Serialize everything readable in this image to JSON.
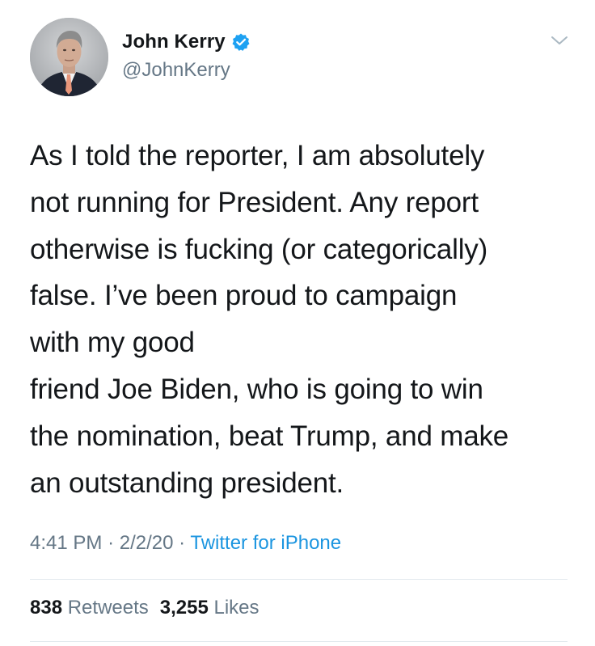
{
  "user": {
    "display_name": "John Kerry",
    "handle": "@JohnKerry",
    "verified": true,
    "avatar_icon": "profile-photo"
  },
  "menu": {
    "icon": "chevron-down-icon"
  },
  "tweet": {
    "lines": [
      "As I told the reporter, I am absolutely",
      "not running for President. Any report",
      "otherwise is fucking (or categorically)",
      "false. I’ve been proud to campaign",
      "with my good",
      "friend Joe Biden, who is going to win",
      "the nomination, beat Trump, and make",
      "an outstanding president."
    ],
    "time": "4:41 PM",
    "date": "2/2/20",
    "separator": "·",
    "source": "Twitter for iPhone"
  },
  "stats": {
    "retweets_count": "838",
    "retweets_label": "Retweets",
    "likes_count": "3,255",
    "likes_label": "Likes"
  },
  "colors": {
    "text": "#14171a",
    "secondary": "#657786",
    "link": "#1b95e0",
    "verified": "#1da1f2",
    "divider": "#e1e8ed"
  }
}
